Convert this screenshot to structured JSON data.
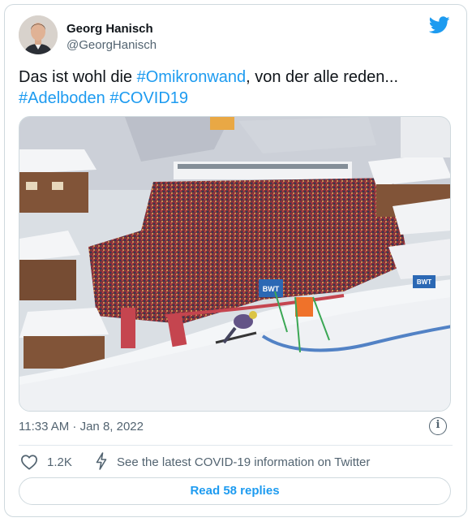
{
  "author": {
    "display_name": "Georg Hanisch",
    "handle": "@GeorgHanisch",
    "avatar_icon": "person-portrait"
  },
  "platform_icon": "twitter-bird-icon",
  "tweet": {
    "text_prefix": "Das ist wohl die ",
    "hashtag_1": "#Omikronwand",
    "text_middle": ", von der alle reden...",
    "hashtag_2": "#Adelboden",
    "hashtag_3": "#COVID19"
  },
  "media": {
    "banner_1": "BWT",
    "banner_2": "BWT"
  },
  "meta": {
    "timestamp": "11:33 AM · Jan 8, 2022",
    "info_icon": "info-icon"
  },
  "actions": {
    "like_count": "1.2K",
    "covid_info": "See the latest COVID-19 information on Twitter",
    "read_replies": "Read 58 replies"
  },
  "colors": {
    "accent": "#1d9bf0",
    "secondary_text": "#536471",
    "primary_text": "#0f1419",
    "border": "#cfd9de"
  }
}
